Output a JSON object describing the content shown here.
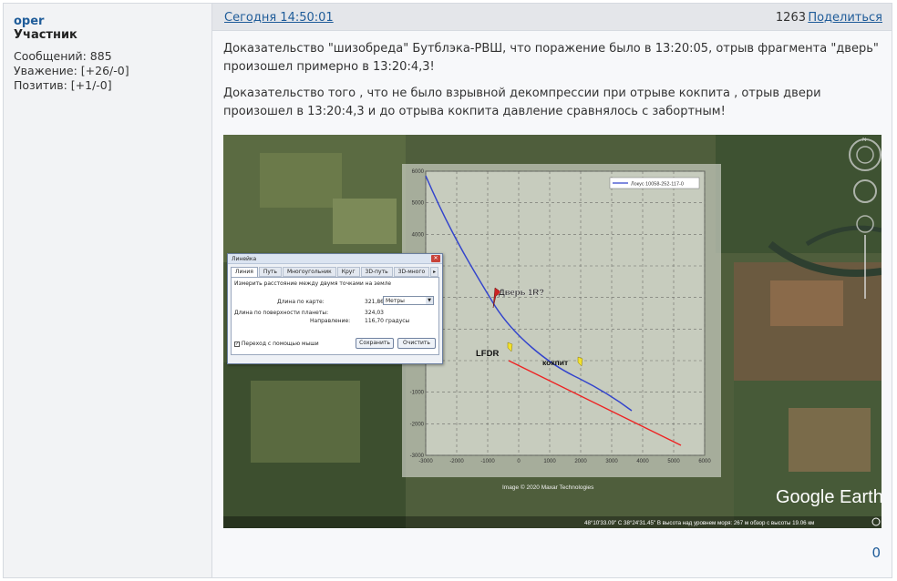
{
  "author": {
    "name": "oper",
    "rank": "Участник",
    "messages": "Сообщений: 885",
    "respect": "Уважение: [+26/-0]",
    "positive": "Позитив: [+1/-0]"
  },
  "post": {
    "date": "Сегодня 14:50:01",
    "views": "1263",
    "share": "Поделиться",
    "paragraphs": [
      "Доказательство \"шизобреда\" Бутблэка-РВШ, что поражение было в 13:20:05, отрыв фрагмента \"дверь\" произошел примерно в 13:20:4,3!",
      "Доказательство того , что не было взрывной декомпрессии при отрыве кокпита , отрыв двери произошел в 13:20:4,3 и до отрыва кокпита давление сравнялось с забортным!"
    ],
    "likes": "0"
  },
  "image": {
    "plot": {
      "legend": "Локус 10058-252-117-0",
      "y_ticks": [
        "6000",
        "5000",
        "4000",
        "3000",
        "2000",
        "1000",
        "0",
        "-1000",
        "-2000",
        "-3000"
      ],
      "x_ticks": [
        "-3000",
        "-2000",
        "-1000",
        "0",
        "1000",
        "2000",
        "3000",
        "4000",
        "5000",
        "6000"
      ]
    },
    "placemarks": {
      "door": "Дверь 1R?",
      "lfdr": "LFDR",
      "cockpit": "кокпит"
    },
    "ruler": {
      "title": "Линейка",
      "tabs": [
        "Линия",
        "Путь",
        "Многоугольник",
        "Круг",
        "3D-путь",
        "3D-много"
      ],
      "instruction": "Измерить расстояние между двумя точками на земле",
      "map_length_label": "Длина по карте:",
      "map_length_value": "321,86",
      "unit": "Метры",
      "ground_length_label": "Длина по поверхности планеты:",
      "ground_length_value": "324,03",
      "heading_label": "Направление:",
      "heading_value": "116,70 градусы",
      "mouse_nav": "Переход с помощью мыши",
      "save": "Сохранить",
      "clear": "Очистить"
    },
    "copyright": "Image © 2020 Maxar Technologies",
    "brand": "Google Earth",
    "status_bar": "48°10'33.09\" С  38°24'31.45\" В  высота над уровнем моря:  267 м   обзор с высоты  19.06 км"
  },
  "colors": {
    "link": "#1f5c99",
    "header_bg": "#e4e6ea",
    "blue_line": "#3344cc",
    "red_line": "#ee2222"
  }
}
